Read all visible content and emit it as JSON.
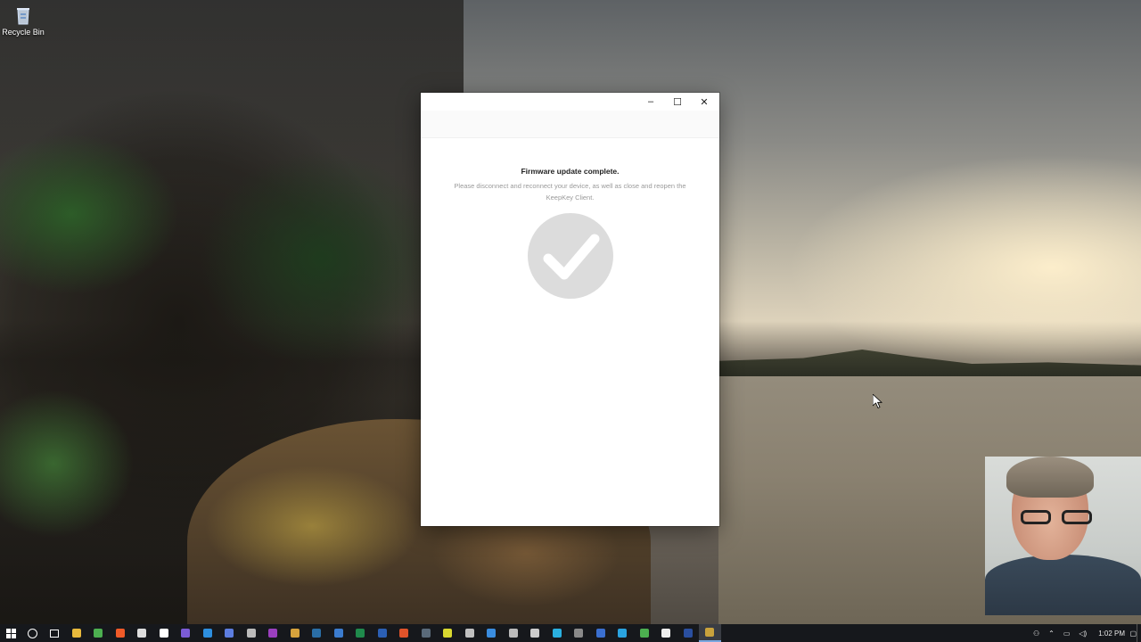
{
  "desktop": {
    "icons": [
      {
        "label": "Recycle Bin",
        "icon": "recycle-bin-icon"
      }
    ]
  },
  "window": {
    "controls": {
      "minimize": "–",
      "maximize": "☐",
      "close": "✕"
    },
    "title": "Firmware update complete.",
    "message": "Please disconnect and reconnect your device, as well as close and reopen the KeepKey Client.",
    "status_icon": "check-circle-icon"
  },
  "taskbar": {
    "start_icon": "windows-start-icon",
    "apps": [
      {
        "icon": "file-explorer-icon",
        "color": "#e8b93c"
      },
      {
        "icon": "chrome-icon",
        "color": "#4caf50"
      },
      {
        "icon": "brave-icon",
        "color": "#f05a28"
      },
      {
        "icon": "app-icon",
        "color": "#dddddd"
      },
      {
        "icon": "mail-icon",
        "color": "#ffffff"
      },
      {
        "icon": "app-icon",
        "color": "#7b5cd6"
      },
      {
        "icon": "app-icon",
        "color": "#2d8fe0"
      },
      {
        "icon": "app-icon",
        "color": "#5c7de0"
      },
      {
        "icon": "app-icon",
        "color": "#bbbbbb"
      },
      {
        "icon": "app-icon",
        "color": "#9b3fbf"
      },
      {
        "icon": "app-icon",
        "color": "#d6a23c"
      },
      {
        "icon": "photoshop-icon",
        "color": "#2a6ea6"
      },
      {
        "icon": "app-icon",
        "color": "#3b7ccf"
      },
      {
        "icon": "excel-icon",
        "color": "#1f8a4c"
      },
      {
        "icon": "word-icon",
        "color": "#2b5fb4"
      },
      {
        "icon": "app-icon",
        "color": "#e0532a"
      },
      {
        "icon": "app-icon",
        "color": "#5a6a7a"
      },
      {
        "icon": "app-icon",
        "color": "#d8d830"
      },
      {
        "icon": "app-icon",
        "color": "#c0c0c0"
      },
      {
        "icon": "app-icon",
        "color": "#3a8de0"
      },
      {
        "icon": "app-icon",
        "color": "#bbbbbb"
      },
      {
        "icon": "app-icon",
        "color": "#cccccc"
      },
      {
        "icon": "app-icon",
        "color": "#2ab0e0"
      },
      {
        "icon": "app-icon",
        "color": "#8a8a8a"
      },
      {
        "icon": "app-icon",
        "color": "#3a6fd0"
      },
      {
        "icon": "skype-icon",
        "color": "#2aa3e0"
      },
      {
        "icon": "app-icon",
        "color": "#4caf50"
      },
      {
        "icon": "app-icon",
        "color": "#eeeeee"
      },
      {
        "icon": "app-icon",
        "color": "#2a4fa0"
      },
      {
        "icon": "keepkey-icon",
        "color": "#c9a23c",
        "active": true
      }
    ],
    "tray": {
      "clock": "1:02 PM",
      "icons": [
        "person-icon",
        "chevron-up-icon",
        "network-icon",
        "volume-icon",
        "notification-icon"
      ]
    }
  }
}
